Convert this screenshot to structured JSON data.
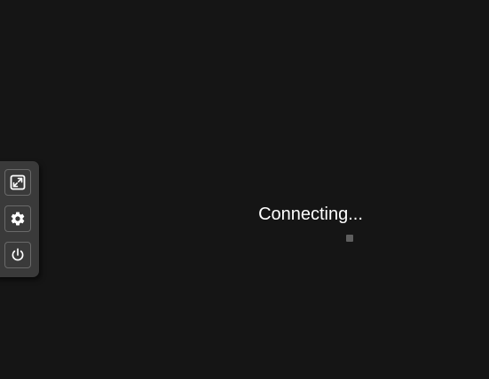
{
  "screen": {
    "background_color": "#151515"
  },
  "toolbar": {
    "background_color": "#3a3a3a",
    "buttons": [
      {
        "icon": "fullscreen-icon",
        "label": ""
      },
      {
        "icon": "gear-icon",
        "label": ""
      },
      {
        "icon": "power-icon",
        "label": ""
      }
    ]
  },
  "status": {
    "message": "Connecting..."
  }
}
